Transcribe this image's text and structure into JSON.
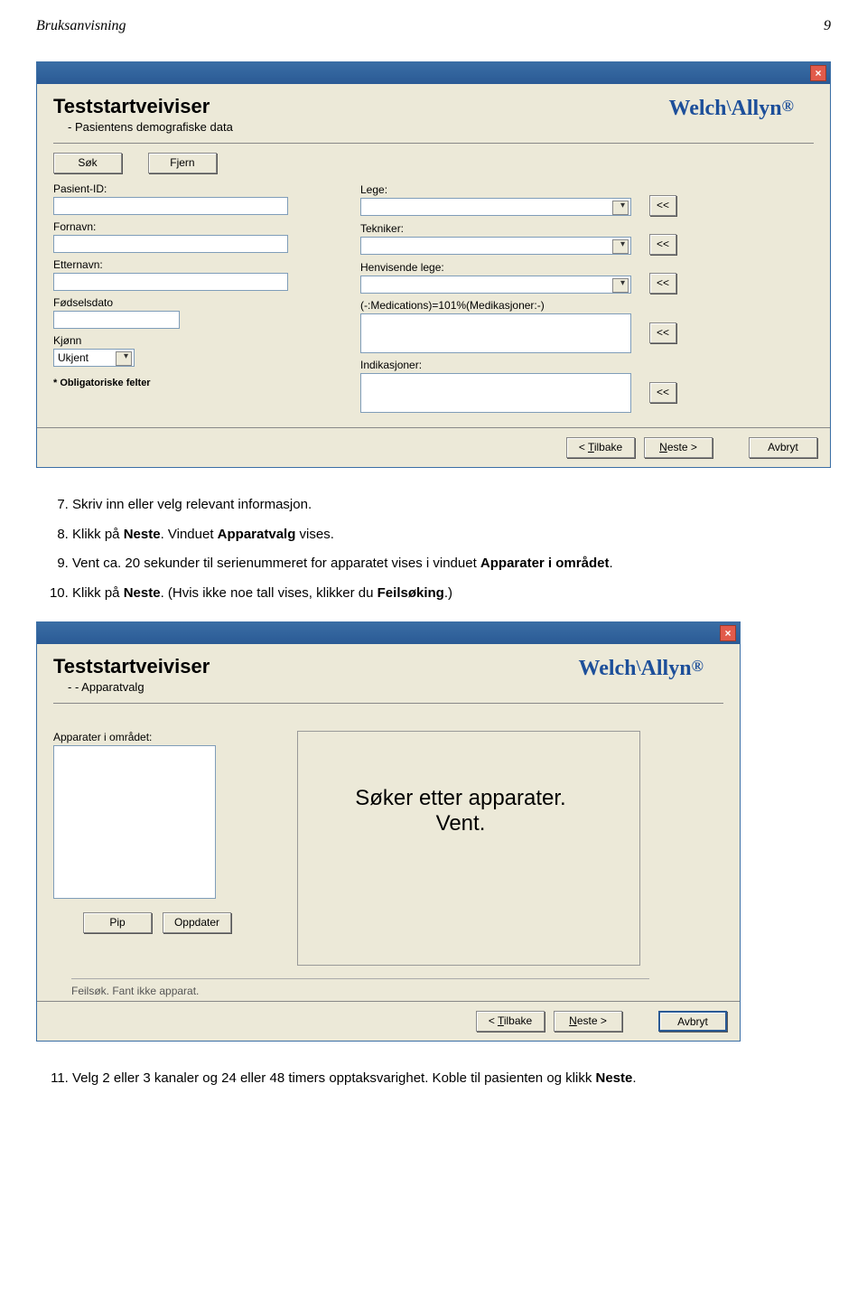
{
  "header": {
    "left": "Bruksanvisning",
    "right": "9"
  },
  "logo": {
    "main": "Welch",
    "mid": "Allyn",
    "reg": "®"
  },
  "win1": {
    "title": "Teststartveiviser",
    "subtitle": "-  Pasientens demografiske data",
    "btn_search": "Søk",
    "btn_clear": "Fjern",
    "lbl_patientid": "Pasient-ID:",
    "lbl_firstname": "Fornavn:",
    "lbl_lastname": "Etternavn:",
    "lbl_dob": "Fødselsdato",
    "lbl_gender": "Kjønn",
    "val_gender": "Ukjent",
    "lbl_doctor": "Lege:",
    "lbl_technician": "Tekniker:",
    "lbl_refdoc": "Henvisende lege:",
    "lbl_meds": "(-:Medications)=101%(Medikasjoner:-)",
    "lbl_indications": "Indikasjoner:",
    "arrow": "<<",
    "mandatory": "* Obligatoriske felter",
    "btn_back": "< Tilbake",
    "btn_next": "Neste >",
    "btn_cancel": "Avbryt"
  },
  "steps_a": {
    "s7": "Skriv inn eller velg relevant informasjon.",
    "s8_pre": "Klikk på ",
    "s8_bold": "Neste",
    "s8_post": ". Vinduet ",
    "s8_bold2": "Apparatvalg",
    "s8_post2": " vises.",
    "s9_pre": "Vent ca. 20 sekunder til serienummeret for apparatet vises i vinduet ",
    "s9_bold": "Apparater i området",
    "s9_post": ".",
    "s10_pre": "Klikk på ",
    "s10_bold": "Neste",
    "s10_post": ". (Hvis ikke noe tall vises, klikker du ",
    "s10_bold2": "Feilsøking",
    "s10_post2": ".)"
  },
  "win2": {
    "title": "Teststartveiviser",
    "subtitle": "- - Apparatvalg",
    "lbl_devices": "Apparater i området:",
    "scan1": "Søker etter apparater.",
    "scan2": "Vent.",
    "btn_pip": "Pip",
    "btn_update": "Oppdater",
    "status": "Feilsøk. Fant ikke apparat.",
    "btn_back": "< Tilbake",
    "btn_next": "Neste >",
    "btn_cancel": "Avbryt"
  },
  "steps_b": {
    "s11_pre": "Velg 2 eller 3 kanaler og 24 eller 48 timers opptaksvarighet. Koble til pasienten og klikk ",
    "s11_bold": "Neste",
    "s11_post": "."
  }
}
